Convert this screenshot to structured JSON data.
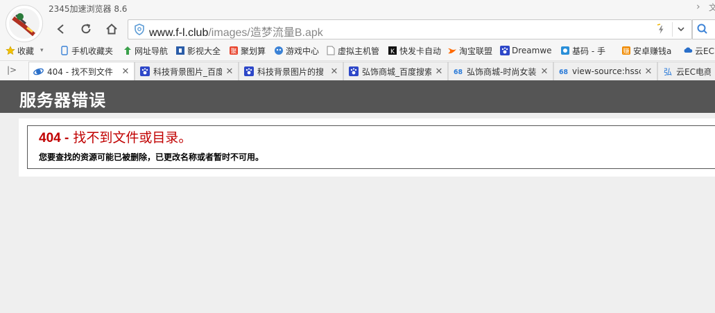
{
  "window": {
    "app_title": "2345加速浏览器 8.6",
    "corner_text": "文"
  },
  "nav": {
    "back": "back",
    "refresh": "refresh",
    "home": "home"
  },
  "address": {
    "host": "www.f-l.club",
    "path": "/images/造梦流量B.apk"
  },
  "bookmarks": [
    {
      "label": "收藏",
      "icon": "star-icon"
    },
    {
      "label": "手机收藏夹",
      "icon": "phone-icon"
    },
    {
      "label": "网址导航",
      "icon": "nav-icon"
    },
    {
      "label": "影视大全",
      "icon": "film-icon"
    },
    {
      "label": "聚划算",
      "icon": "juhuasuan-icon"
    },
    {
      "label": "游戏中心",
      "icon": "game-icon"
    },
    {
      "label": "虚拟主机管",
      "icon": "page-icon"
    },
    {
      "label": "快发卡自动",
      "icon": "k-icon"
    },
    {
      "label": "淘宝联盟",
      "icon": "taobao-icon"
    },
    {
      "label": "Dreamwe",
      "icon": "paw-icon"
    },
    {
      "label": "基码 - 手",
      "icon": "jima-icon"
    },
    {
      "label": "安卓赚钱a",
      "icon": "zhuan-icon"
    },
    {
      "label": "云EC",
      "icon": "cloud-icon"
    }
  ],
  "tabs": [
    {
      "label": "404 - 找不到文件",
      "icon": "ie-icon",
      "active": true
    },
    {
      "label": "科技背景图片_百度",
      "icon": "paw-icon",
      "active": false
    },
    {
      "label": "科技背景图片的搜",
      "icon": "paw-icon",
      "active": false
    },
    {
      "label": "弘饰商城_百度搜索",
      "icon": "paw-icon",
      "active": false
    },
    {
      "label": "弘饰商城-时尚女装",
      "icon": "68-icon",
      "active": false
    },
    {
      "label": "view-source:hssc",
      "icon": "68-icon",
      "active": false
    },
    {
      "label": "云EC电商",
      "icon": "hong-icon",
      "active": false
    }
  ],
  "page": {
    "header": "服务器错误",
    "error_code": "404 -",
    "error_title": " 找不到文件或目录。",
    "error_desc": "您要查找的资源可能已被删除，已更改名称或者暂时不可用。"
  },
  "colors": {
    "header_bg": "#555555",
    "error_red": "#c00000",
    "accent_blue": "#3b82d6"
  }
}
